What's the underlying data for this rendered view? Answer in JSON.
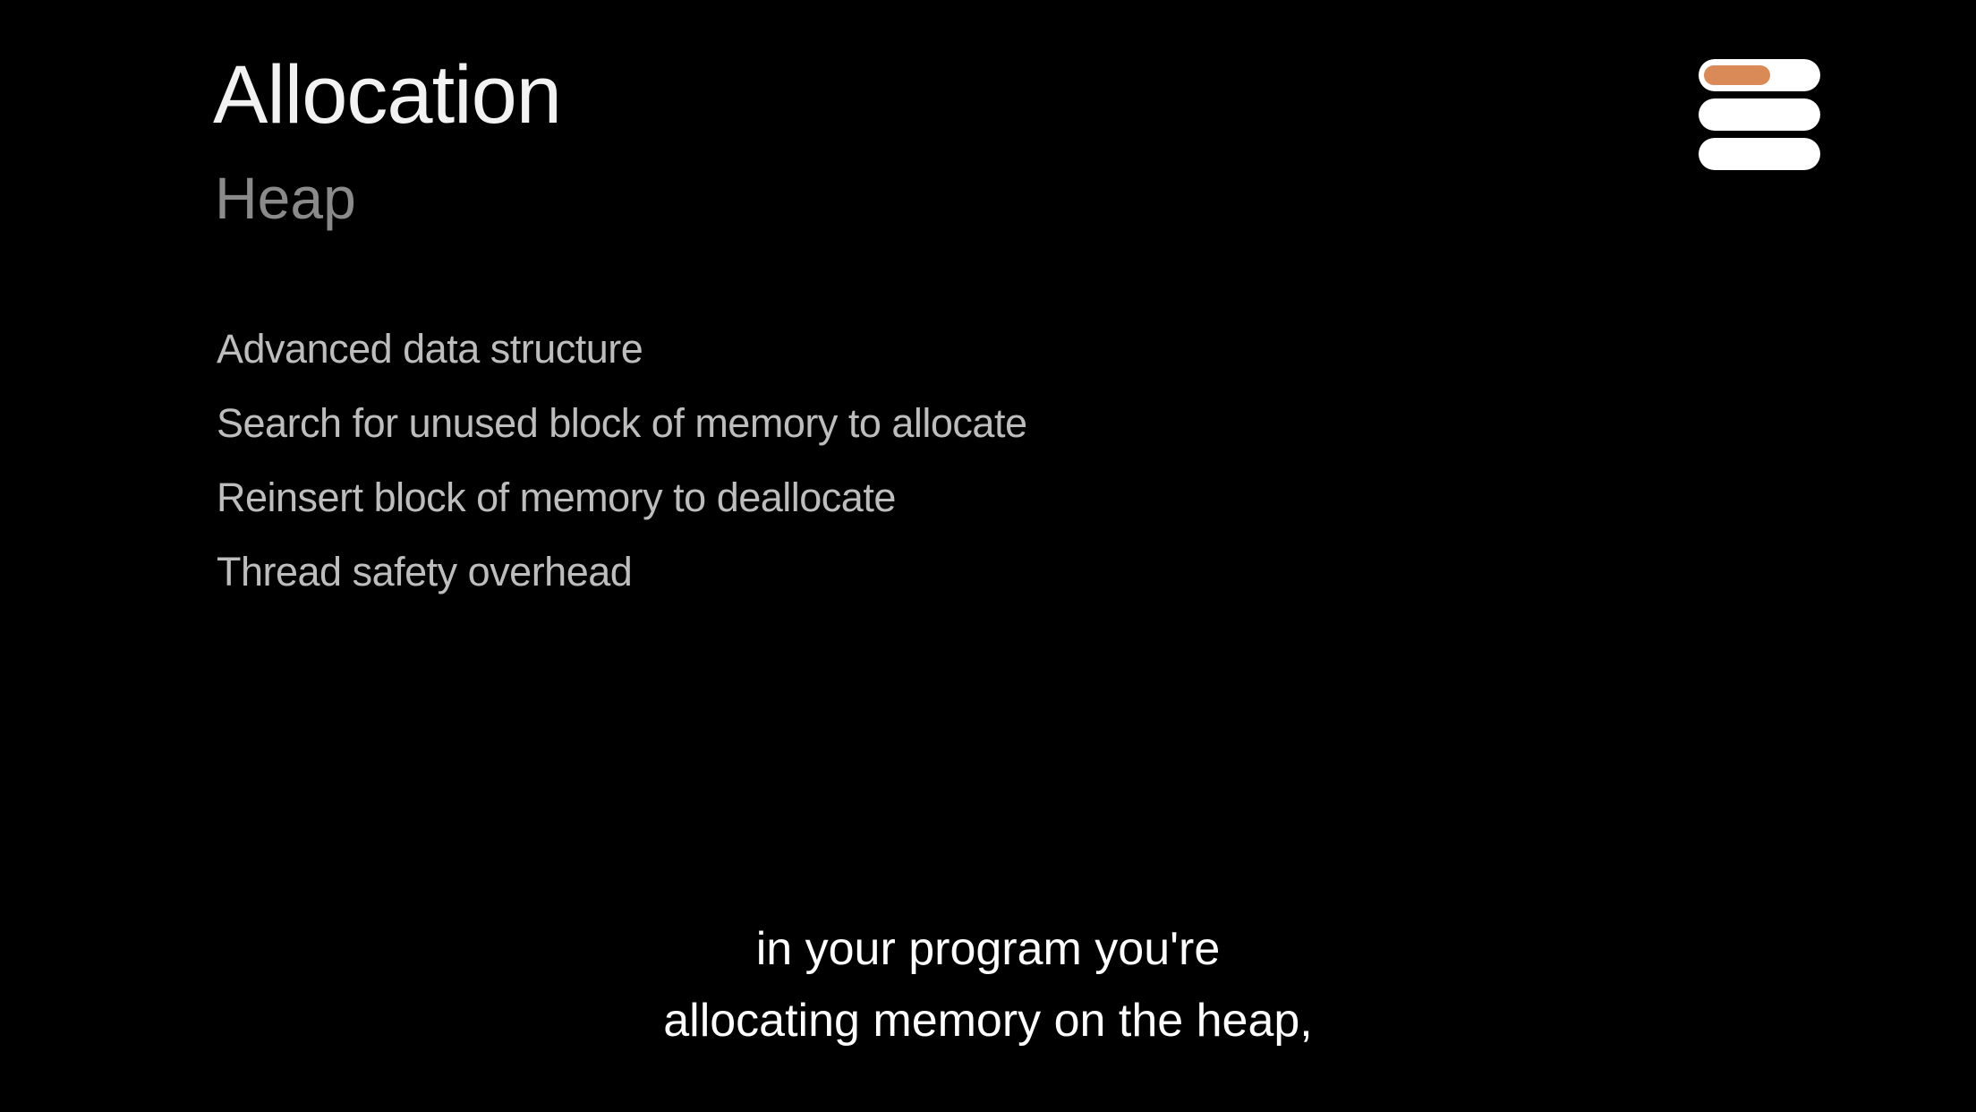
{
  "slide": {
    "title": "Allocation",
    "subtitle": "Heap",
    "bullets": [
      "Advanced data structure",
      "Search for unused block of memory to allocate",
      "Reinsert block of memory to deallocate",
      "Thread safety overhead"
    ],
    "indicator": {
      "icon": "memory-stack-icon",
      "active_fill_fraction": 0.6,
      "active_color": "#d98a57"
    }
  },
  "caption": {
    "lines": [
      "in your program you're",
      "allocating memory on the heap,"
    ]
  },
  "colors": {
    "background": "#000000",
    "title": "#f2f2f2",
    "subtitle": "#8a8a8a",
    "bullet_text": "#bdbdbd",
    "caption_text": "#ffffff"
  }
}
